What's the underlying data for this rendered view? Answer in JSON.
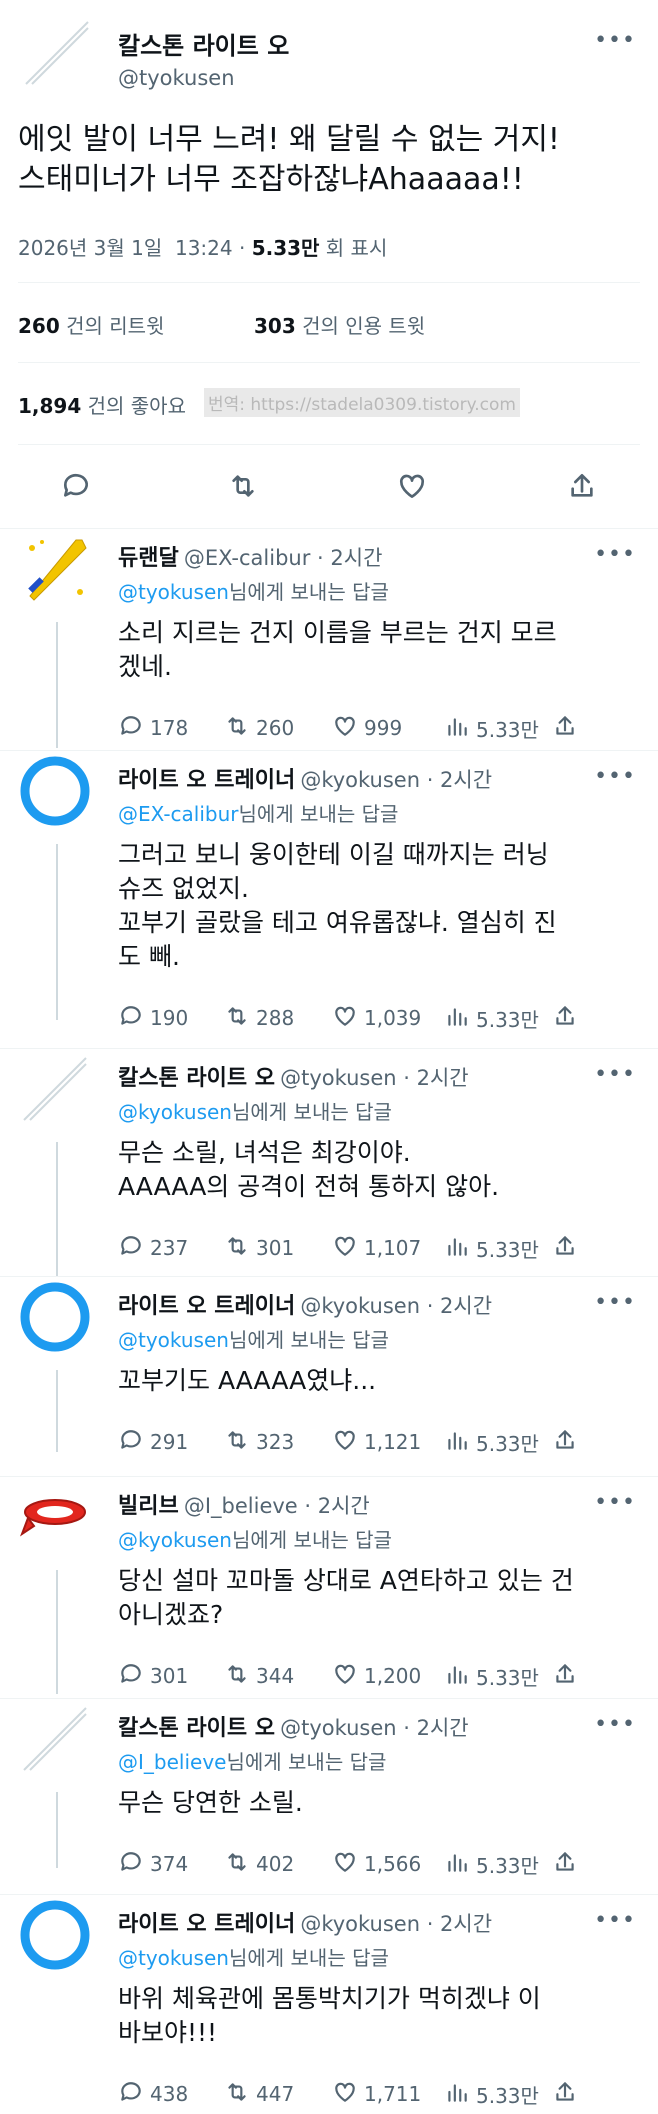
{
  "main": {
    "author_name": "칼스톤 라이트 오",
    "author_handle": "@tyokusen",
    "text_line1": "에잇 발이 너무 느려! 왜 달릴 수 없는 거지!",
    "text_line2": "스태미너가 너무 조잡하잖냐Ahaaaaa!!",
    "date": "2026년 3월 1일  13:24 · ",
    "views_count": "5.33만",
    "views_label": " 회 표시",
    "retweets_count": "260",
    "retweets_label": "건의 리트윗",
    "quotes_count": "303",
    "quotes_label": "건의 인용 트윗",
    "likes_count": "1,894",
    "likes_label": "건의 좋아요",
    "watermark": "번역: https://stadela0309.tistory.com"
  },
  "replies": [
    {
      "name": "듀랜달",
      "handle": "@EX-calibur · 2시간",
      "to": "@tyokusen",
      "suffix": "님에게 보내는 답글",
      "text": "소리 지르는 건지 이름을 부르는 건지 모르\n겠네.",
      "reply": "178",
      "rt": "260",
      "like": "999",
      "views": "5.33만"
    },
    {
      "name": "라이트 오 트레이너",
      "handle": "@kyokusen · 2시간",
      "to": "@EX-calibur",
      "suffix": "님에게 보내는 답글",
      "text": "그러고 보니 웅이한테 이길 때까지는 러닝\n슈즈 없었지.\n꼬부기 골랐을 테고 여유롭잖냐. 열심히 진\n도 빼.",
      "reply": "190",
      "rt": "288",
      "like": "1,039",
      "views": "5.33만"
    },
    {
      "name": "칼스톤 라이트 오",
      "handle": "@tyokusen · 2시간",
      "to": "@kyokusen",
      "suffix": "님에게 보내는 답글",
      "text": "무슨 소릴, 녀석은 최강이야.\nAAAAA의 공격이 전혀 통하지 않아.",
      "reply": "237",
      "rt": "301",
      "like": "1,107",
      "views": "5.33만"
    },
    {
      "name": "라이트 오 트레이너",
      "handle": "@kyokusen · 2시간",
      "to": "@tyokusen",
      "suffix": "님에게 보내는 답글",
      "text": "꼬부기도 AAAAA였냐...",
      "reply": "291",
      "rt": "323",
      "like": "1,121",
      "views": "5.33만"
    },
    {
      "name": "빌리브",
      "handle": "@I_believe · 2시간",
      "to": "@kyokusen",
      "suffix": "님에게 보내는 답글",
      "text": "당신 설마 꼬마돌 상대로 A연타하고 있는 건\n아니겠죠?",
      "reply": "301",
      "rt": "344",
      "like": "1,200",
      "views": "5.33만"
    },
    {
      "name": "칼스톤 라이트 오",
      "handle": "@tyokusen · 2시간",
      "to": "@I_believe",
      "suffix": "님에게 보내는 답글",
      "text": "무슨 당연한 소릴.",
      "reply": "374",
      "rt": "402",
      "like": "1,566",
      "views": "5.33만"
    },
    {
      "name": "라이트 오 트레이너",
      "handle": "@kyokusen · 2시간",
      "to": "@tyokusen",
      "suffix": "님에게 보내는 답글",
      "text": "바위 체육관에 몸통박치기가 먹히겠냐 이\n바보야!!!",
      "reply": "438",
      "rt": "447",
      "like": "1,711",
      "views": "5.33만"
    }
  ],
  "colors": {
    "accent": "#1d9bf0",
    "muted": "#536471",
    "divider": "#eff3f4"
  },
  "icons": [
    "more-icon",
    "reply-icon",
    "retweet-icon",
    "like-icon",
    "share-icon",
    "views-icon"
  ]
}
